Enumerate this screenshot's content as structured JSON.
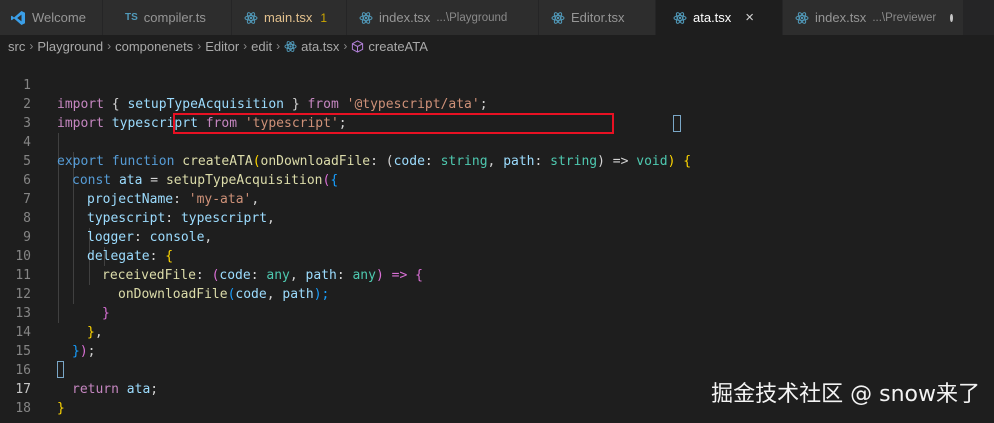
{
  "tabs": [
    {
      "label": "Welcome",
      "icon": "vscode-icon"
    },
    {
      "label": "compiler.ts",
      "icon": "ts-icon"
    },
    {
      "label": "main.tsx",
      "badge": "1",
      "icon": "react-icon",
      "modified": true
    },
    {
      "label": "index.tsx",
      "description": "...\\Playground",
      "icon": "react-icon"
    },
    {
      "label": "Editor.tsx",
      "icon": "react-icon"
    },
    {
      "label": "ata.tsx",
      "icon": "react-icon",
      "active": true
    },
    {
      "label": "index.tsx",
      "description": "...\\Previewer",
      "icon": "react-icon",
      "unsaved": true
    }
  ],
  "ts_icon_text": "TS",
  "close_glyph": "×",
  "breadcrumb": [
    "src",
    "Playground",
    "componenets",
    "Editor",
    "edit",
    "ata.tsx",
    "createATA"
  ],
  "code": {
    "line_numbers": [
      "1",
      "2",
      "3",
      "4",
      "5",
      "6",
      "7",
      "8",
      "9",
      "10",
      "11",
      "12",
      "13",
      "14",
      "15",
      "16",
      "17",
      "18"
    ],
    "l1": [
      "import",
      " { ",
      "setupTypeAcquisition",
      " } ",
      "from",
      " ",
      "'@typescript/ata'",
      ";"
    ],
    "l2": [
      "import",
      " ",
      "typescriprt",
      " ",
      "from",
      " ",
      "'typescript'",
      ";"
    ],
    "l4": [
      "export",
      " ",
      "function",
      " ",
      "createATA",
      "(",
      "onDownloadFile",
      ": (",
      "code",
      ": ",
      "string",
      ", ",
      "path",
      ": ",
      "string",
      ") => ",
      "void",
      ") ",
      "{"
    ],
    "l5": [
      "const",
      " ",
      "ata",
      " = ",
      "setupTypeAcquisition",
      "(",
      "{"
    ],
    "l6": [
      "projectName",
      ": ",
      "'my-ata'",
      ","
    ],
    "l7": [
      "typescript",
      ": ",
      "typescriprt",
      ","
    ],
    "l8": [
      "logger",
      ": ",
      "console",
      ","
    ],
    "l9": [
      "delegate",
      ": ",
      "{"
    ],
    "l10": [
      "receivedFile",
      ": ",
      "(",
      "code",
      ": ",
      "any",
      ", ",
      "path",
      ": ",
      "any",
      ") => ",
      "{"
    ],
    "l11": [
      "onDownloadFile",
      "(",
      "code",
      ", ",
      "path",
      ");"
    ],
    "l12": [
      "}"
    ],
    "l13": [
      "}",
      ","
    ],
    "l14": [
      "}",
      ")",
      ";"
    ],
    "l16": [
      "return",
      " ",
      "ata",
      ";"
    ],
    "l17": [
      "}"
    ]
  },
  "watermark": "掘金技术社区 @ snow来了",
  "colors": {
    "highlight": "#e81123",
    "background": "#1e1e1e",
    "tabbar": "#252526"
  }
}
